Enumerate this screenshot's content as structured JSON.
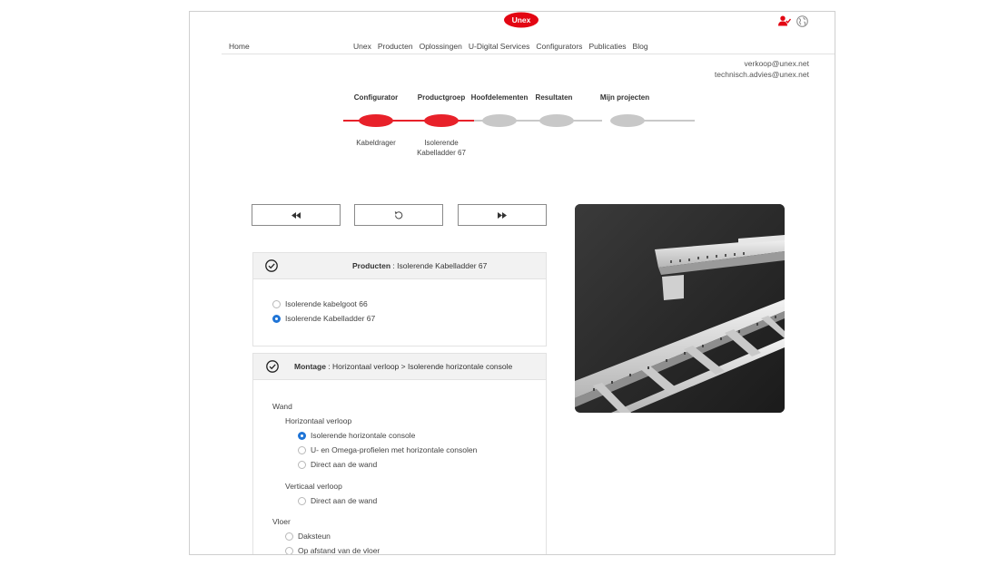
{
  "header": {
    "logo_text": "Unex",
    "brand_color": "#e30613",
    "icons": [
      "user-check-icon",
      "globe-icon"
    ]
  },
  "nav": {
    "home": "Home",
    "items": [
      "Unex",
      "Producten",
      "Oplossingen",
      "U-Digital Services",
      "Configurators",
      "Publicaties",
      "Blog"
    ]
  },
  "contact": {
    "email1": "verkoop@unex.net",
    "email2": "technisch.advies@unex.net"
  },
  "steps": {
    "active_color": "#e8212a",
    "inactive_color": "#c8c8c8",
    "items": [
      {
        "label": "Configurator",
        "value": "Kabeldrager",
        "active": true
      },
      {
        "label": "Productgroep",
        "value_line1": "Isolerende",
        "value_line2": "Kabelladder 67",
        "active": true
      },
      {
        "label": "Hoofdelementen",
        "active": false
      },
      {
        "label": "Resultaten",
        "active": false
      },
      {
        "label": "Mijn projecten",
        "active": false
      }
    ]
  },
  "controls": {
    "back_icon": "rewind-icon",
    "reset_icon": "undo-icon",
    "forward_icon": "fast-forward-icon"
  },
  "products_panel": {
    "title_bold": "Producten",
    "title_rest": " : Isolerende Kabelladder 67",
    "options": [
      {
        "label": "Isolerende kabelgoot 66",
        "selected": false
      },
      {
        "label": "Isolerende Kabelladder 67",
        "selected": true
      }
    ]
  },
  "montage_panel": {
    "title_bold": "Montage",
    "title_rest": " : Horizontaal verloop > Isolerende horizontale console",
    "group_wand": "Wand",
    "sub_horizontal": "Horizontaal verloop",
    "horizontal_options": [
      {
        "label": "Isolerende horizontale console",
        "selected": true
      },
      {
        "label": "U- en Omega-profielen met horizontale consolen",
        "selected": false
      },
      {
        "label": "Direct aan de wand",
        "selected": false
      }
    ],
    "sub_vertical": "Verticaal verloop",
    "vertical_options": [
      {
        "label": "Direct aan de wand",
        "selected": false
      }
    ],
    "group_vloer": "Vloer",
    "vloer_options": [
      {
        "label": "Daksteun",
        "selected": false
      },
      {
        "label": "Op afstand van de vloer",
        "selected": false
      }
    ]
  }
}
